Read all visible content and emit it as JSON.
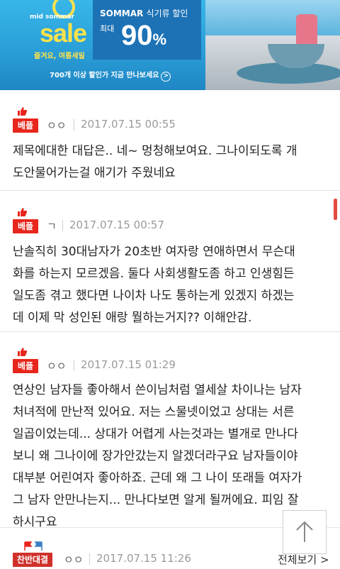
{
  "banner": {
    "logo_small": "mid sommar",
    "logo_sale": "sale",
    "tagline": "즐겨요, 여름세일",
    "brand": "SOMMAR",
    "brand_suffix": "식기류 할인",
    "max_label": "최대",
    "percent": "90",
    "percent_unit": "%",
    "footer": "700개 이상 할인가 지금 만나보세요"
  },
  "comments": [
    {
      "badge": "베플",
      "author": "ㅇㅇ",
      "date": "2017.07.15 00:55",
      "lines": [
        "제목에대한 대답은.. 네~ 멍청해보여요. 그나이되도록 개",
        "도안물어가는걸 애기가 주웠네요"
      ]
    },
    {
      "badge": "베플",
      "author": "ㄱ",
      "date": "2017.07.15 00:57",
      "lines": [
        "난솔직히 30대남자가 20초반 여자랑 연애하면서 무슨대",
        "화를 하는지 모르겠음. 둘다 사회생활도좀 하고 인생힘든",
        "일도좀 겪고 했다면 나이차 나도 통하는게 있겠지 하겠는",
        "데 이제 막 성인된 애랑 뭘하는거지?? 이해안감."
      ]
    },
    {
      "badge": "베플",
      "author": "ㅇㅇ",
      "date": "2017.07.15 01:29",
      "lines": [
        "연상인 남자들 좋아해서 쓴이님처럼 열세살 차이나는 남자",
        "처녀적에 만난적 있어요. 저는 스물넷이었고 상대는 서른",
        "일곱이었는데... 상대가 어렵게 사는것과는 별개로 만나다",
        "보니 왜 그나이에 장가안갔는지 알겠더라구요 남자들이야",
        "대부분 어린여자 좋아하죠. 근데 왜 그 나이 또래들 여자가",
        "그 남자 안만나는지... 만나다보면 알게 될꺼에요. 피임 잘",
        "하시구요"
      ]
    },
    {
      "badge": "찬반대결",
      "author": "ㅇㅇ",
      "date": "2017.07.15 11:26",
      "lines": []
    }
  ],
  "view_all": "전체보기 >",
  "colors": {
    "accent": "#e8261b",
    "banner_blue": "#2a9fd8",
    "promo_blue": "#1d72b5"
  }
}
